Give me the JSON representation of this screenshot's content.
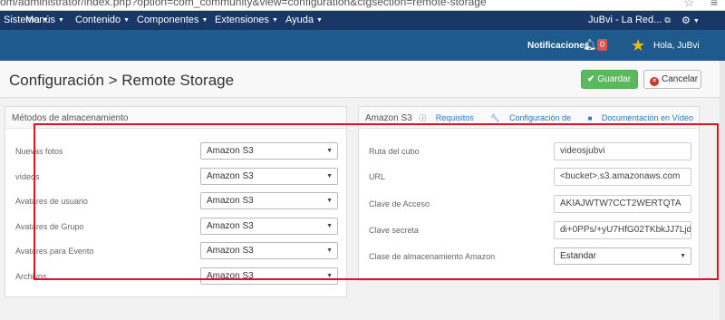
{
  "browser": {
    "url": "om/administrator/index.php?option=com_community&view=configuration&cfgsection=remote-storage"
  },
  "topmenu": {
    "items": [
      "Sistema",
      "Menús",
      "Contenido",
      "Componentes",
      "Extensiones",
      "Ayuda"
    ],
    "site_label": "JuBvi - La Red..."
  },
  "header": {
    "notifications_label": "Notificaciones",
    "notifications_count": "0",
    "greeting": "Hola, JuBvi"
  },
  "titlebar": {
    "title": "Configuración > Remote Storage",
    "save_label": "Guardar",
    "cancel_label": "Cancelar"
  },
  "storage_methods": {
    "title": "Métodos de almacenamiento",
    "rows": [
      {
        "label": "Nuevas fotos",
        "value": "Amazon S3"
      },
      {
        "label": "vídeos",
        "value": "Amazon S3"
      },
      {
        "label": "Avatares de usuario",
        "value": "Amazon S3"
      },
      {
        "label": "Avatares de Grupo",
        "value": "Amazon S3"
      },
      {
        "label": "Avatares para Evento",
        "value": "Amazon S3"
      },
      {
        "label": "Archivos",
        "value": "Amazon S3"
      }
    ]
  },
  "amazon_s3": {
    "title": "Amazon S3",
    "links": {
      "requirements": "Requisitos",
      "configuration": "Configuración de",
      "video_docs": "Documentación en Vídeo"
    },
    "fields": [
      {
        "label": "Ruta del cubo",
        "value": "videosjubvi"
      },
      {
        "label": "URL",
        "value": "<bucket>.s3.amazonaws.com"
      },
      {
        "label": "Clave de Acceso",
        "value": "AKIAJWTW7CCT2WERTQTA"
      },
      {
        "label": "Clave secreta",
        "value": "di+0PPs/+yU7HfG02TKbkJJ7Ljdi"
      }
    ],
    "storage_class": {
      "label": "Clase de almacenamiento Amazon",
      "value": "Estandar"
    }
  },
  "colors": {
    "topmenu_bg": "#1a3867",
    "header_bg": "#1f5a8c",
    "save_green": "#5cb85c",
    "badge_red": "#d9534f",
    "annotation_red": "#e0151b"
  }
}
